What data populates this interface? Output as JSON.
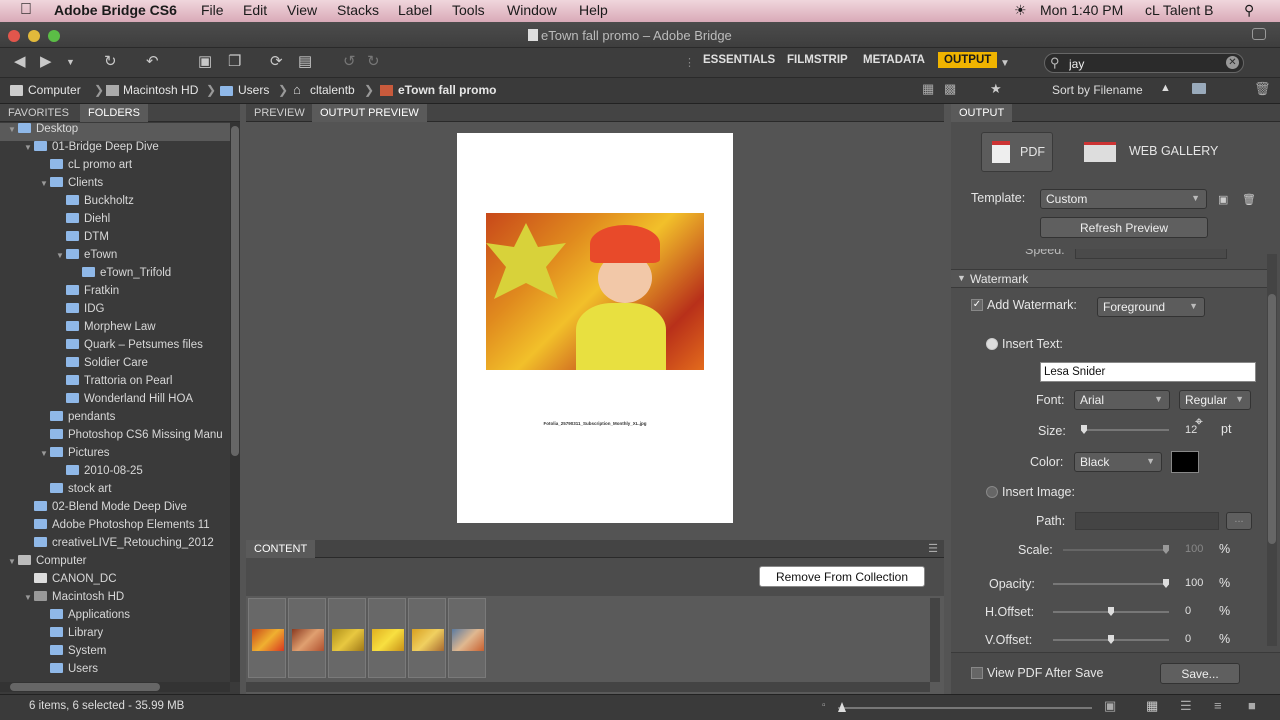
{
  "menubar": {
    "app": "Adobe Bridge CS6",
    "items": [
      "File",
      "Edit",
      "View",
      "Stacks",
      "Label",
      "Tools",
      "Window",
      "Help"
    ],
    "clock": "Mon 1:40 PM",
    "user": "cL Talent B"
  },
  "window": {
    "title": "eTown fall promo – Adobe Bridge"
  },
  "workspaces": {
    "items": [
      "ESSENTIALS",
      "FILMSTRIP",
      "METADATA",
      "OUTPUT"
    ],
    "active": "OUTPUT"
  },
  "search": {
    "value": "jay"
  },
  "breadcrumb": [
    "Computer",
    "Macintosh HD",
    "Users",
    "cltalentb",
    "eTown fall promo"
  ],
  "sort": {
    "label": "Sort by Filename"
  },
  "left_panel": {
    "tabs": [
      "FAVORITES",
      "FOLDERS"
    ],
    "tree": [
      {
        "label": "Desktop",
        "level": 0,
        "sel": true
      },
      {
        "label": "01-Bridge Deep Dive",
        "level": 1
      },
      {
        "label": "cL promo art",
        "level": 2
      },
      {
        "label": "Clients",
        "level": 2
      },
      {
        "label": "Buckholtz",
        "level": 3
      },
      {
        "label": "Diehl",
        "level": 3
      },
      {
        "label": "DTM",
        "level": 3
      },
      {
        "label": "eTown",
        "level": 3
      },
      {
        "label": "eTown_Trifold",
        "level": 4
      },
      {
        "label": "Fratkin",
        "level": 3
      },
      {
        "label": "IDG",
        "level": 3
      },
      {
        "label": "Morphew Law",
        "level": 3
      },
      {
        "label": "Quark – Petsumes files",
        "level": 3
      },
      {
        "label": "Soldier Care",
        "level": 3
      },
      {
        "label": "Trattoria on Pearl",
        "level": 3
      },
      {
        "label": "Wonderland Hill HOA",
        "level": 3
      },
      {
        "label": "pendants",
        "level": 2
      },
      {
        "label": "Photoshop CS6 Missing Manu",
        "level": 2
      },
      {
        "label": "Pictures",
        "level": 2
      },
      {
        "label": "2010-08-25",
        "level": 3
      },
      {
        "label": "stock art",
        "level": 2
      },
      {
        "label": "02-Blend Mode Deep Dive",
        "level": 1
      },
      {
        "label": "Adobe Photoshop Elements 11",
        "level": 1
      },
      {
        "label": "creativeLIVE_Retouching_2012",
        "level": 1
      },
      {
        "label": "Computer",
        "level": 0
      },
      {
        "label": "CANON_DC",
        "level": 1
      },
      {
        "label": "Macintosh HD",
        "level": 1
      },
      {
        "label": "Applications",
        "level": 2
      },
      {
        "label": "Library",
        "level": 2
      },
      {
        "label": "System",
        "level": 2
      },
      {
        "label": "Users",
        "level": 2
      }
    ]
  },
  "preview": {
    "tabs": [
      "PREVIEW",
      "OUTPUT PREVIEW"
    ],
    "filename": "Fotolia_25790311_Subscription_Monthly_XL.jpg"
  },
  "content": {
    "tab": "CONTENT",
    "remove_button": "Remove From Collection",
    "thumb_count": 6
  },
  "output": {
    "tab": "OUTPUT",
    "pdf": "PDF",
    "web_gallery": "WEB GALLERY",
    "template_label": "Template:",
    "template_value": "Custom",
    "refresh": "Refresh Preview",
    "cut_label": "Speed:",
    "watermark_section": "Watermark",
    "add_watermark": "Add Watermark:",
    "watermark_mode": "Foreground",
    "insert_text": "Insert Text:",
    "text_value": "Lesa Snider",
    "font_label": "Font:",
    "font_value": "Arial",
    "style_value": "Regular",
    "size_label": "Size:",
    "size_value": "12",
    "size_unit": "pt",
    "color_label": "Color:",
    "color_value": "Black",
    "insert_image": "Insert Image:",
    "path_label": "Path:",
    "path_button": "...",
    "scale_label": "Scale:",
    "scale_value": "100",
    "opacity_label": "Opacity:",
    "opacity_value": "100",
    "hoffset_label": "H.Offset:",
    "hoffset_value": "0",
    "voffset_label": "V.Offset:",
    "voffset_value": "0",
    "pct": "%",
    "view_pdf": "View PDF After Save",
    "save": "Save..."
  },
  "status": {
    "text": "6 items, 6 selected - 35.99 MB"
  },
  "colors": {
    "accent": "#f0b400",
    "panel": "#4e4e4e",
    "folder": "#8fb8e8"
  }
}
